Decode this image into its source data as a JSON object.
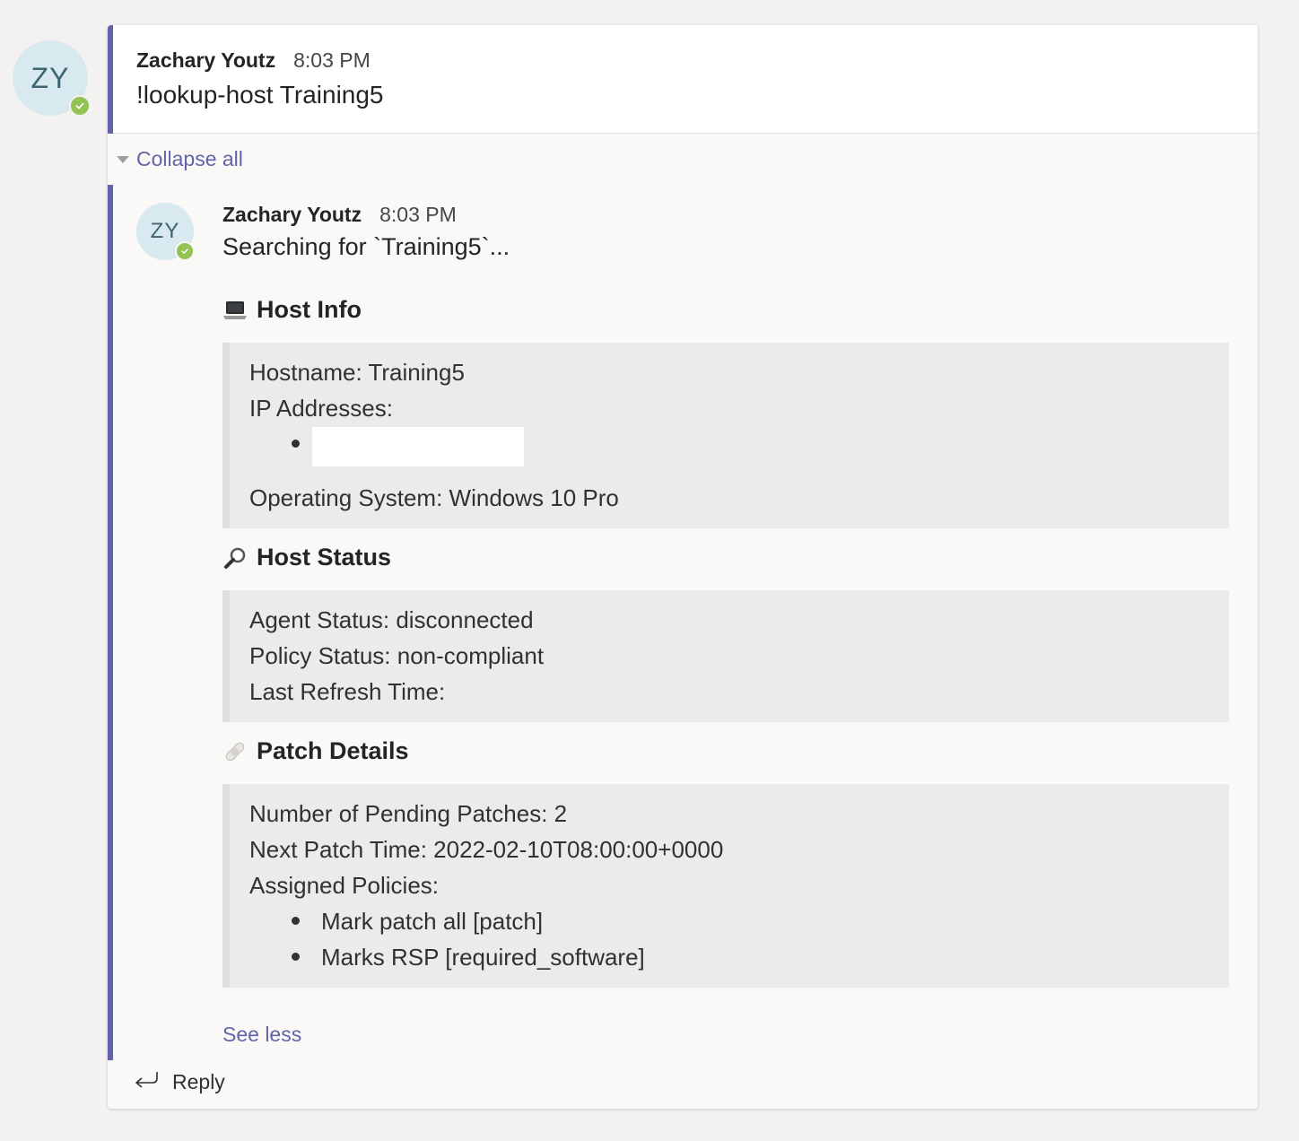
{
  "root_message": {
    "avatar_initials": "ZY",
    "author": "Zachary Youtz",
    "time": "8:03 PM",
    "text": "!lookup-host Training5"
  },
  "thread_controls": {
    "collapse_all_label": "Collapse all",
    "see_less_label": "See less",
    "reply_label": "Reply"
  },
  "reply_message": {
    "avatar_initials": "ZY",
    "author": "Zachary Youtz",
    "time": "8:03 PM",
    "text": "Searching for `Training5`...",
    "sections": {
      "host_info": {
        "icon": "laptop-icon",
        "title": "Host Info",
        "hostname": "Hostname: Training5",
        "ip_label": "IP Addresses:",
        "operating_system": "Operating System: Windows 10 Pro"
      },
      "host_status": {
        "icon": "magnifier-icon",
        "title": "Host Status",
        "agent_status": "Agent Status: disconnected",
        "policy_status": "Policy Status: non-compliant",
        "last_refresh": "Last Refresh Time:"
      },
      "patch_details": {
        "icon": "bandage-icon",
        "title": "Patch Details",
        "pending": "Number of Pending Patches: 2",
        "next_time": "Next Patch Time: 2022-02-10T08:00:00+0000",
        "policies_label": "Assigned Policies:",
        "policies": [
          "Mark patch all [patch]",
          "Marks RSP [required_software]"
        ]
      }
    }
  },
  "colors": {
    "accent": "#6264a7",
    "presence_available": "#92c353",
    "avatar_bg": "#d8e9ef"
  }
}
